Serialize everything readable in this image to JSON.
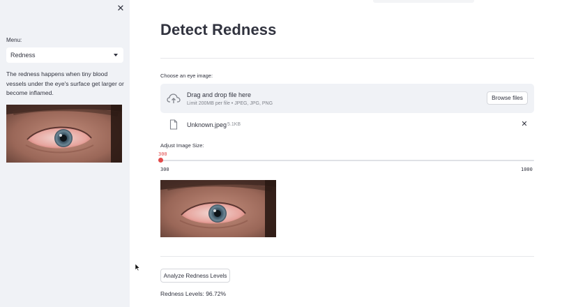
{
  "sidebar": {
    "menu_label": "Menu:",
    "selected_option": "Redness",
    "description": "The redness happens when tiny blood vessels under the eye's surface get larger or become inflamed."
  },
  "main": {
    "title": "Detect Redness",
    "uploader": {
      "label": "Choose an eye image:",
      "drop_title": "Drag and drop file here",
      "drop_subtitle": "Limit 200MB per file • JPEG, JPG, PNG",
      "browse_label": "Browse files"
    },
    "file": {
      "name": "Unknown.jpeg",
      "size": "5.1KB"
    },
    "slider": {
      "label": "Adjust Image Size:",
      "value": "300",
      "min": "300",
      "max": "1000"
    },
    "analyze_label": "Analyze Redness Levels",
    "result_text": "Redness Levels: 96.72%"
  },
  "icons": {
    "close": "close-icon",
    "dropdown": "chevron-down-icon",
    "upload": "cloud-upload-icon",
    "file": "file-icon",
    "remove": "close-icon"
  },
  "colors": {
    "sidebar_bg": "#f0f2f6",
    "accent": "#e24a4a",
    "text": "#31333f"
  }
}
